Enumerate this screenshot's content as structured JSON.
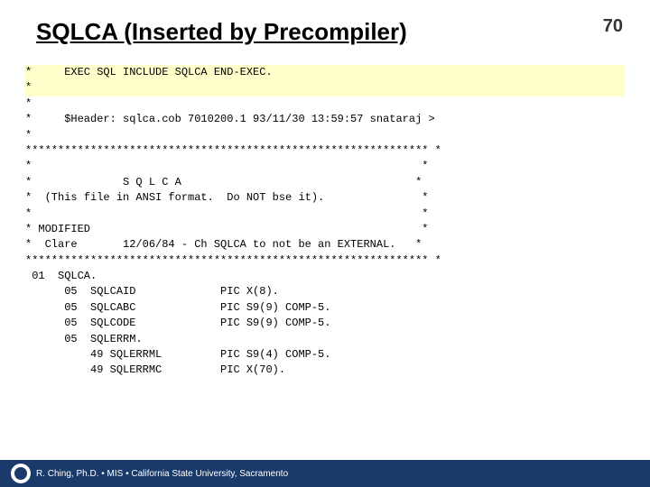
{
  "slide": {
    "title": "SQLCA (Inserted by Precompiler)",
    "slide_number": "70",
    "code_lines": [
      {
        "text": "*     EXEC SQL INCLUDE SQLCA END-EXEC.",
        "highlight": true
      },
      {
        "text": "*",
        "highlight": true
      },
      {
        "text": "*",
        "highlight": false
      },
      {
        "text": "*     $Header: sqlca.cob 7010200.1 93/11/30 13:59:57 snataraj >",
        "highlight": false
      },
      {
        "text": "*",
        "highlight": false
      },
      {
        "text": "************************************************************** *",
        "highlight": false
      },
      {
        "text": "*                                                            *",
        "highlight": false
      },
      {
        "text": "*              S Q L C A                                    *",
        "highlight": false
      },
      {
        "text": "*  (This file in ANSI format.  Do NOT bse it).               *",
        "highlight": false
      },
      {
        "text": "*                                                            *",
        "highlight": false
      },
      {
        "text": "* MODIFIED                                                   *",
        "highlight": false
      },
      {
        "text": "*  Clare       12/06/84 - Ch SQLCA to not be an EXTERNAL.   *",
        "highlight": false
      },
      {
        "text": "************************************************************** *",
        "highlight": false
      },
      {
        "text": " 01  SQLCA.",
        "highlight": false
      },
      {
        "text": "      05  SQLCAID             PIC X(8).",
        "highlight": false
      },
      {
        "text": "      05  SQLCABC             PIC S9(9) COMP-5.",
        "highlight": false
      },
      {
        "text": "      05  SQLCODE             PIC S9(9) COMP-5.",
        "highlight": false
      },
      {
        "text": "      05  SQLERRM.",
        "highlight": false
      },
      {
        "text": "          49 SQLERRML         PIC S9(4) COMP-5.",
        "highlight": false
      },
      {
        "text": "          49 SQLERRMC         PIC X(70).",
        "highlight": false
      }
    ],
    "footer": {
      "text": "R. Ching, Ph.D. • MIS • California State University, Sacramento"
    }
  }
}
